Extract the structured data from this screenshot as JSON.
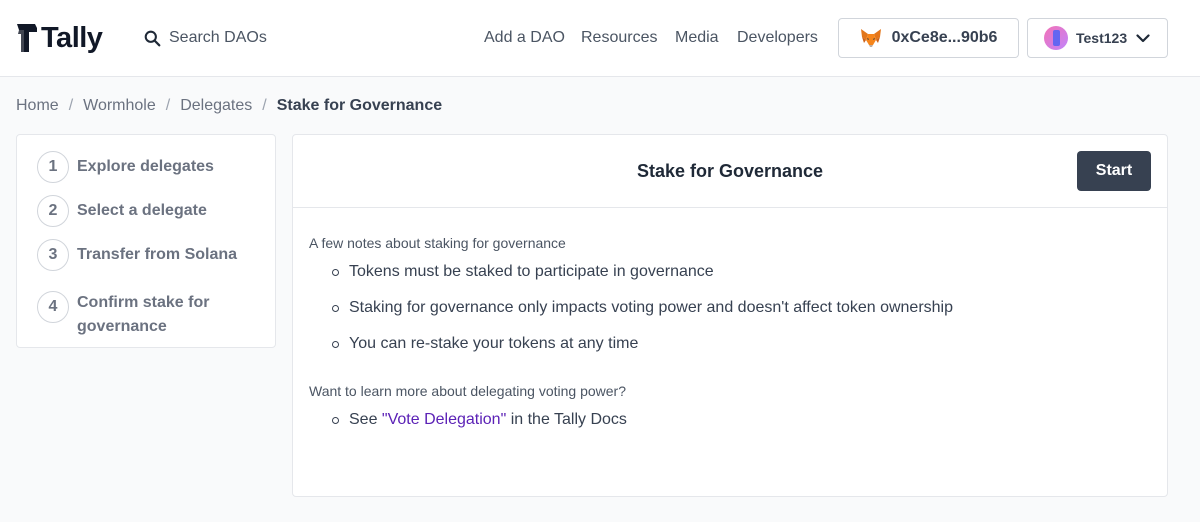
{
  "header": {
    "logo_text": "Tally",
    "search_placeholder": "Search DAOs",
    "nav": [
      "Add a DAO",
      "Resources",
      "Media",
      "Developers"
    ],
    "wallet_address": "0xCe8e...90b6",
    "user_name": "Test123"
  },
  "breadcrumb": {
    "items": [
      "Home",
      "Wormhole",
      "Delegates"
    ],
    "current": "Stake for Governance"
  },
  "steps": [
    {
      "num": "1",
      "label": "Explore delegates"
    },
    {
      "num": "2",
      "label": "Select a delegate"
    },
    {
      "num": "3",
      "label": "Transfer from Solana"
    },
    {
      "num": "4",
      "label": "Confirm stake for governance"
    }
  ],
  "card": {
    "title": "Stake for Governance",
    "start_label": "Start",
    "notes_heading": "A few notes about staking for governance",
    "notes": [
      "Tokens must be staked to participate in governance",
      "Staking for governance only impacts voting power and doesn't affect token ownership",
      "You can re-stake your tokens at any time"
    ],
    "learn_heading": "Want to learn more about delegating voting power?",
    "learn_prefix": "See ",
    "learn_link": "\"Vote Delegation\"",
    "learn_suffix": " in the Tally Docs"
  },
  "colors": {
    "primary_button": "#374151",
    "link": "#5b21b6",
    "background": "#f9fafb"
  },
  "icons": [
    "tally-logo-icon",
    "search-icon",
    "metamask-fox-icon",
    "user-avatar",
    "chevron-down-icon"
  ]
}
